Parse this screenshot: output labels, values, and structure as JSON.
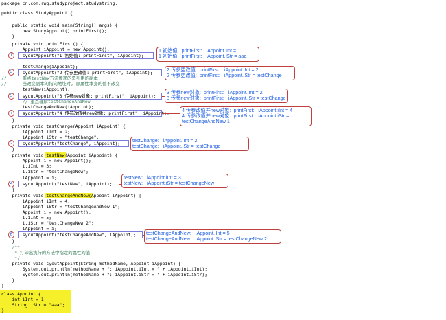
{
  "code": {
    "package_line": "package cn.com.rwq.studyproject.studystring;",
    "class_line": "public class StudyAppoint {",
    "main_sig": "    public static void main(String[] args) {",
    "main_body": "        new StudyAppoint().printFirst();",
    "close1": "    }",
    "printFirst_sig": "    private void printFirst() {",
    "pf_l1": "        Appoint iAppoint = new Appoint();",
    "pf_l2": "        syoutAppoint(\"1 初始值: printFirst\", iAppoint);",
    "pf_l3": "        testChange(iAppoint);",
    "pf_l4": "        syoutAppoint(\"2 传参更改值: printFirst\", iAppoint);",
    "pf_c1": "//      重点testNew方法传递的是引用的副本,",
    "pf_c2": "//      当改变副本的指向地址时, 原属性本身的值不改变",
    "pf_l5": "        testNew(iAppoint);",
    "pf_l6": "        syoutAppoint(\"3 传参new对象: printFirst\", iAppoint);",
    "pf_c3": "        // 重点理解testChangeAndNew",
    "pf_l7": "        testChangeAndNew(iAppoint);",
    "pf_l8": "        syoutAppoint(\"4 传参改值并new对象: printFirst\", iAppoint);",
    "close2": "    }",
    "tc_sig": "    private void testChange(Appoint iAppoint) {",
    "tc_l1": "        iAppoint.iInt = 2;",
    "tc_l2": "        iAppoint.iStr = \"testChange\";",
    "tc_l3": "        syoutAppoint(\"testChange\", iAppoint);",
    "close3": "    }",
    "tn_sig": "    private void testNew(Appoint iAppoint) {",
    "tn_l1": "        Appoint i = new Appoint();",
    "tn_l2": "        i.iInt = 3;",
    "tn_l3": "        i.iStr = \"testChangeNew\";",
    "tn_l4": "        iAppoint = i;",
    "tn_l5": "        syoutAppoint(\"testNew\", iAppoint);",
    "close4": "    }",
    "tcn_sig": "    private void testChangeAndNew(Appoint iAppoint) {",
    "tcn_l1": "        iAppoint.iInt = 4;",
    "tcn_l2": "        iAppoint.iStr = \"testChangeAndNew 1\";",
    "tcn_l3": "        Appoint i = new Appoint();",
    "tcn_l4": "        i.iInt = 5;",
    "tcn_l5": "        i.iStr = \"testChangeNew 2\";",
    "tcn_l6": "        iAppoint = i;",
    "tcn_l7": "        syoutAppoint(\"testChangeAndNew\", iAppoint);",
    "close5": "    }",
    "doc1": "    /**",
    "doc2": "     * 打印出执行的方法中指定的属性的值",
    "doc3": "     */",
    "sa_sig": "    private void syoutAppoint(String methodName, Appoint iAppoint) {",
    "sa_l1": "        System.out.println(methodName + \": iAppoint.iInt = \" + iAppoint.iInt);",
    "sa_l2": "        System.out.println(methodName + \": iAppoint.iStr = \" + iAppoint.iStr);",
    "close6": "    }",
    "close7": "}",
    "ap_sig": "class Appoint {",
    "ap_l1": "    int iInt = 1;",
    "ap_l2": "    String iStr = \"aaa\";",
    "close8": "}"
  },
  "annotations": {
    "a1_l1": "1 初始值:  printFirst:   iAppoint.iInt = 1",
    "a1_l2": "1 初始值:  printFirst:   iAppoint.iStr = aaa",
    "a2_l1": "2 传参更改值:  printFirst:   iAppoint.iInt = 2",
    "a2_l2": "2 传参更改值:  printFirst:   iAppoint.iStr = testChange",
    "a3_l1": "3 传参new对象:  printFirst:   iAppoint.iInt = 2",
    "a3_l2": "3 传参new对象:  printFirst:   iAppoint.iStr = testChange",
    "a4_l1": "4 传参改值并new对象:  printFirst:   iAppoint.iInt = 4",
    "a4_l2": "4 传参改值并new对象:  printFirst:   iAppoint.iStr =",
    "a4_l3": "testChangeAndNew 1",
    "b1_l1": "testChange:   iAppoint.iInt = 2",
    "b1_l2": "testChange:   iAppoint.iStr = testChange",
    "b2_l1": "testNew:   iAppoint.iInt = 3",
    "b2_l2": "testNew:   iAppoint.iStr = testChangeNew",
    "b3_l1": "testChangeAndNew:   iAppoint.iInt = 5",
    "b3_l2": "testChangeAndNew:   iAppoint.iStr = testChangeNew 2"
  },
  "markers": {
    "m1": "1",
    "m2": "3",
    "m3": "5",
    "m4": "7",
    "m5": "2",
    "m6": "4",
    "m7": "6"
  },
  "colors": {
    "annotation": "#2060e0",
    "box": "#c04040",
    "highlight": "#f6f02a"
  }
}
